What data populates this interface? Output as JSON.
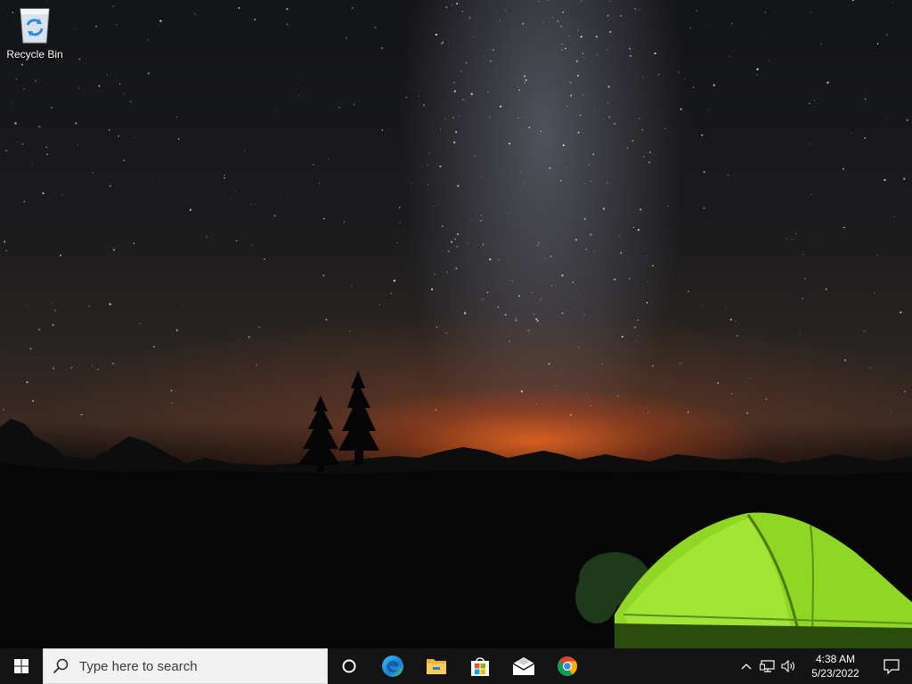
{
  "desktop": {
    "icons": [
      {
        "label": "Recycle Bin",
        "icon": "recycle-bin-icon"
      }
    ]
  },
  "taskbar": {
    "start_icon": "windows-logo-icon",
    "search": {
      "placeholder": "Type here to search",
      "icon": "search-icon"
    },
    "cortana_icon": "cortana-icon",
    "pinned_apps": [
      {
        "name": "Microsoft Edge",
        "icon": "edge-icon"
      },
      {
        "name": "File Explorer",
        "icon": "folder-icon"
      },
      {
        "name": "Microsoft Store",
        "icon": "store-icon"
      },
      {
        "name": "Mail",
        "icon": "mail-icon"
      },
      {
        "name": "Google Chrome",
        "icon": "chrome-icon"
      }
    ],
    "tray": {
      "icons": [
        "chevron-up-icon",
        "network-icon",
        "volume-icon"
      ],
      "time": "4:38 AM",
      "date": "5/23/2022",
      "notification_icon": "notification-icon"
    }
  },
  "colors": {
    "taskbar_bg": "#141414",
    "search_bg": "#f2f2f2",
    "windows_blue": "#ffffff",
    "tent_green": "#9fe52c",
    "horizon_glow": "#ff6e1e"
  }
}
